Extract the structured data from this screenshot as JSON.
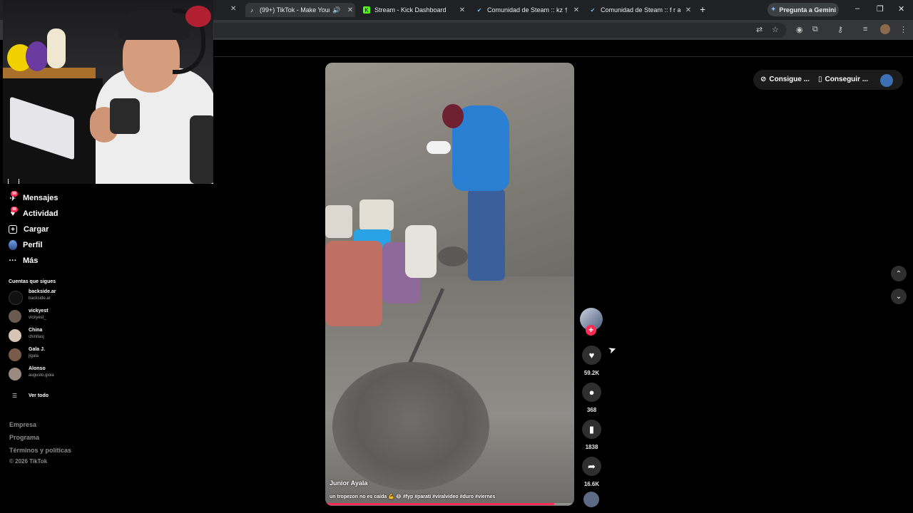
{
  "browser": {
    "tabs": [
      {
        "title": "(99+) TikTok - Make Your Day",
        "icon": "tiktok-icon",
        "active": true
      },
      {
        "title": "Stream - Kick Dashboard",
        "icon": "kick-icon",
        "active": false
      },
      {
        "title": "Comunidad de Steam :: kz †",
        "icon": "steam-icon",
        "active": false
      },
      {
        "title": "Comunidad de Steam :: f r a",
        "icon": "steam-icon",
        "active": false
      }
    ],
    "gemini_label": "Pregunta a Gemini",
    "new_tab_symbol": "+",
    "window_controls": [
      "–",
      "❐",
      "✕"
    ]
  },
  "sidebar": {
    "nav": [
      {
        "label": "Mensajes",
        "icon": "message-icon",
        "badge": "99"
      },
      {
        "label": "Actividad",
        "icon": "activity-icon",
        "badge": "99"
      },
      {
        "label": "Cargar",
        "icon": "upload-icon",
        "badge": ""
      },
      {
        "label": "Perfil",
        "icon": "profile-icon",
        "badge": ""
      },
      {
        "label": "Más",
        "icon": "more-icon",
        "badge": ""
      }
    ],
    "following_title": "Cuentas que sigues",
    "following": [
      {
        "name": "backside.ar",
        "handle": "backside.ar"
      },
      {
        "name": "vickyest",
        "handle": "vickyest_"
      },
      {
        "name": "China",
        "handle": "chinitasj"
      },
      {
        "name": "Gala J.",
        "handle": "jlgala"
      },
      {
        "name": "Alonso",
        "handle": "augusto.gioia"
      }
    ],
    "see_all": "Ver todo",
    "footer_links": [
      "Empresa",
      "Programa",
      "Términos y políticas"
    ],
    "copyright": "© 2026 TikTok"
  },
  "video": {
    "author": "Junior Ayala",
    "caption": "un tropezon no es caída 💪 😂 #fyp #parati #viralvideo #duro #viernes",
    "progress": 0.92
  },
  "actions": {
    "likes": "59.2K",
    "comments": "368",
    "saves": "1838",
    "shares": "16.6K"
  },
  "right_panel": {
    "get_coins": "Consigue ...",
    "get_app": "Conseguir ..."
  },
  "colors": {
    "accent": "#fe2c55",
    "background": "#000000",
    "chrome": "#202124"
  }
}
